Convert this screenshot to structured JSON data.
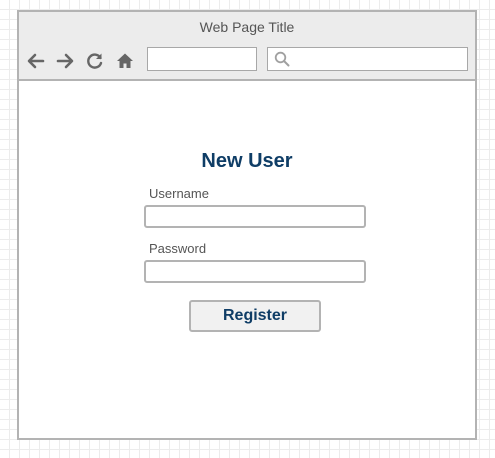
{
  "window": {
    "title": "Web Page Title"
  },
  "toolbar": {
    "buttons": [
      {
        "icon": "back-arrow-icon"
      },
      {
        "icon": "forward-arrow-icon"
      },
      {
        "icon": "reload-icon"
      },
      {
        "icon": "home-icon"
      }
    ],
    "url_value": "",
    "search_value": "",
    "search_icon": "search-icon"
  },
  "form": {
    "title": "New User",
    "username_label": "Username",
    "username_value": "",
    "password_label": "Password",
    "password_value": "",
    "register_label": "Register"
  },
  "colors": {
    "accent": "#0f3d66",
    "chrome": "#ececec",
    "border": "#b3b3b3",
    "icon": "#666666"
  }
}
